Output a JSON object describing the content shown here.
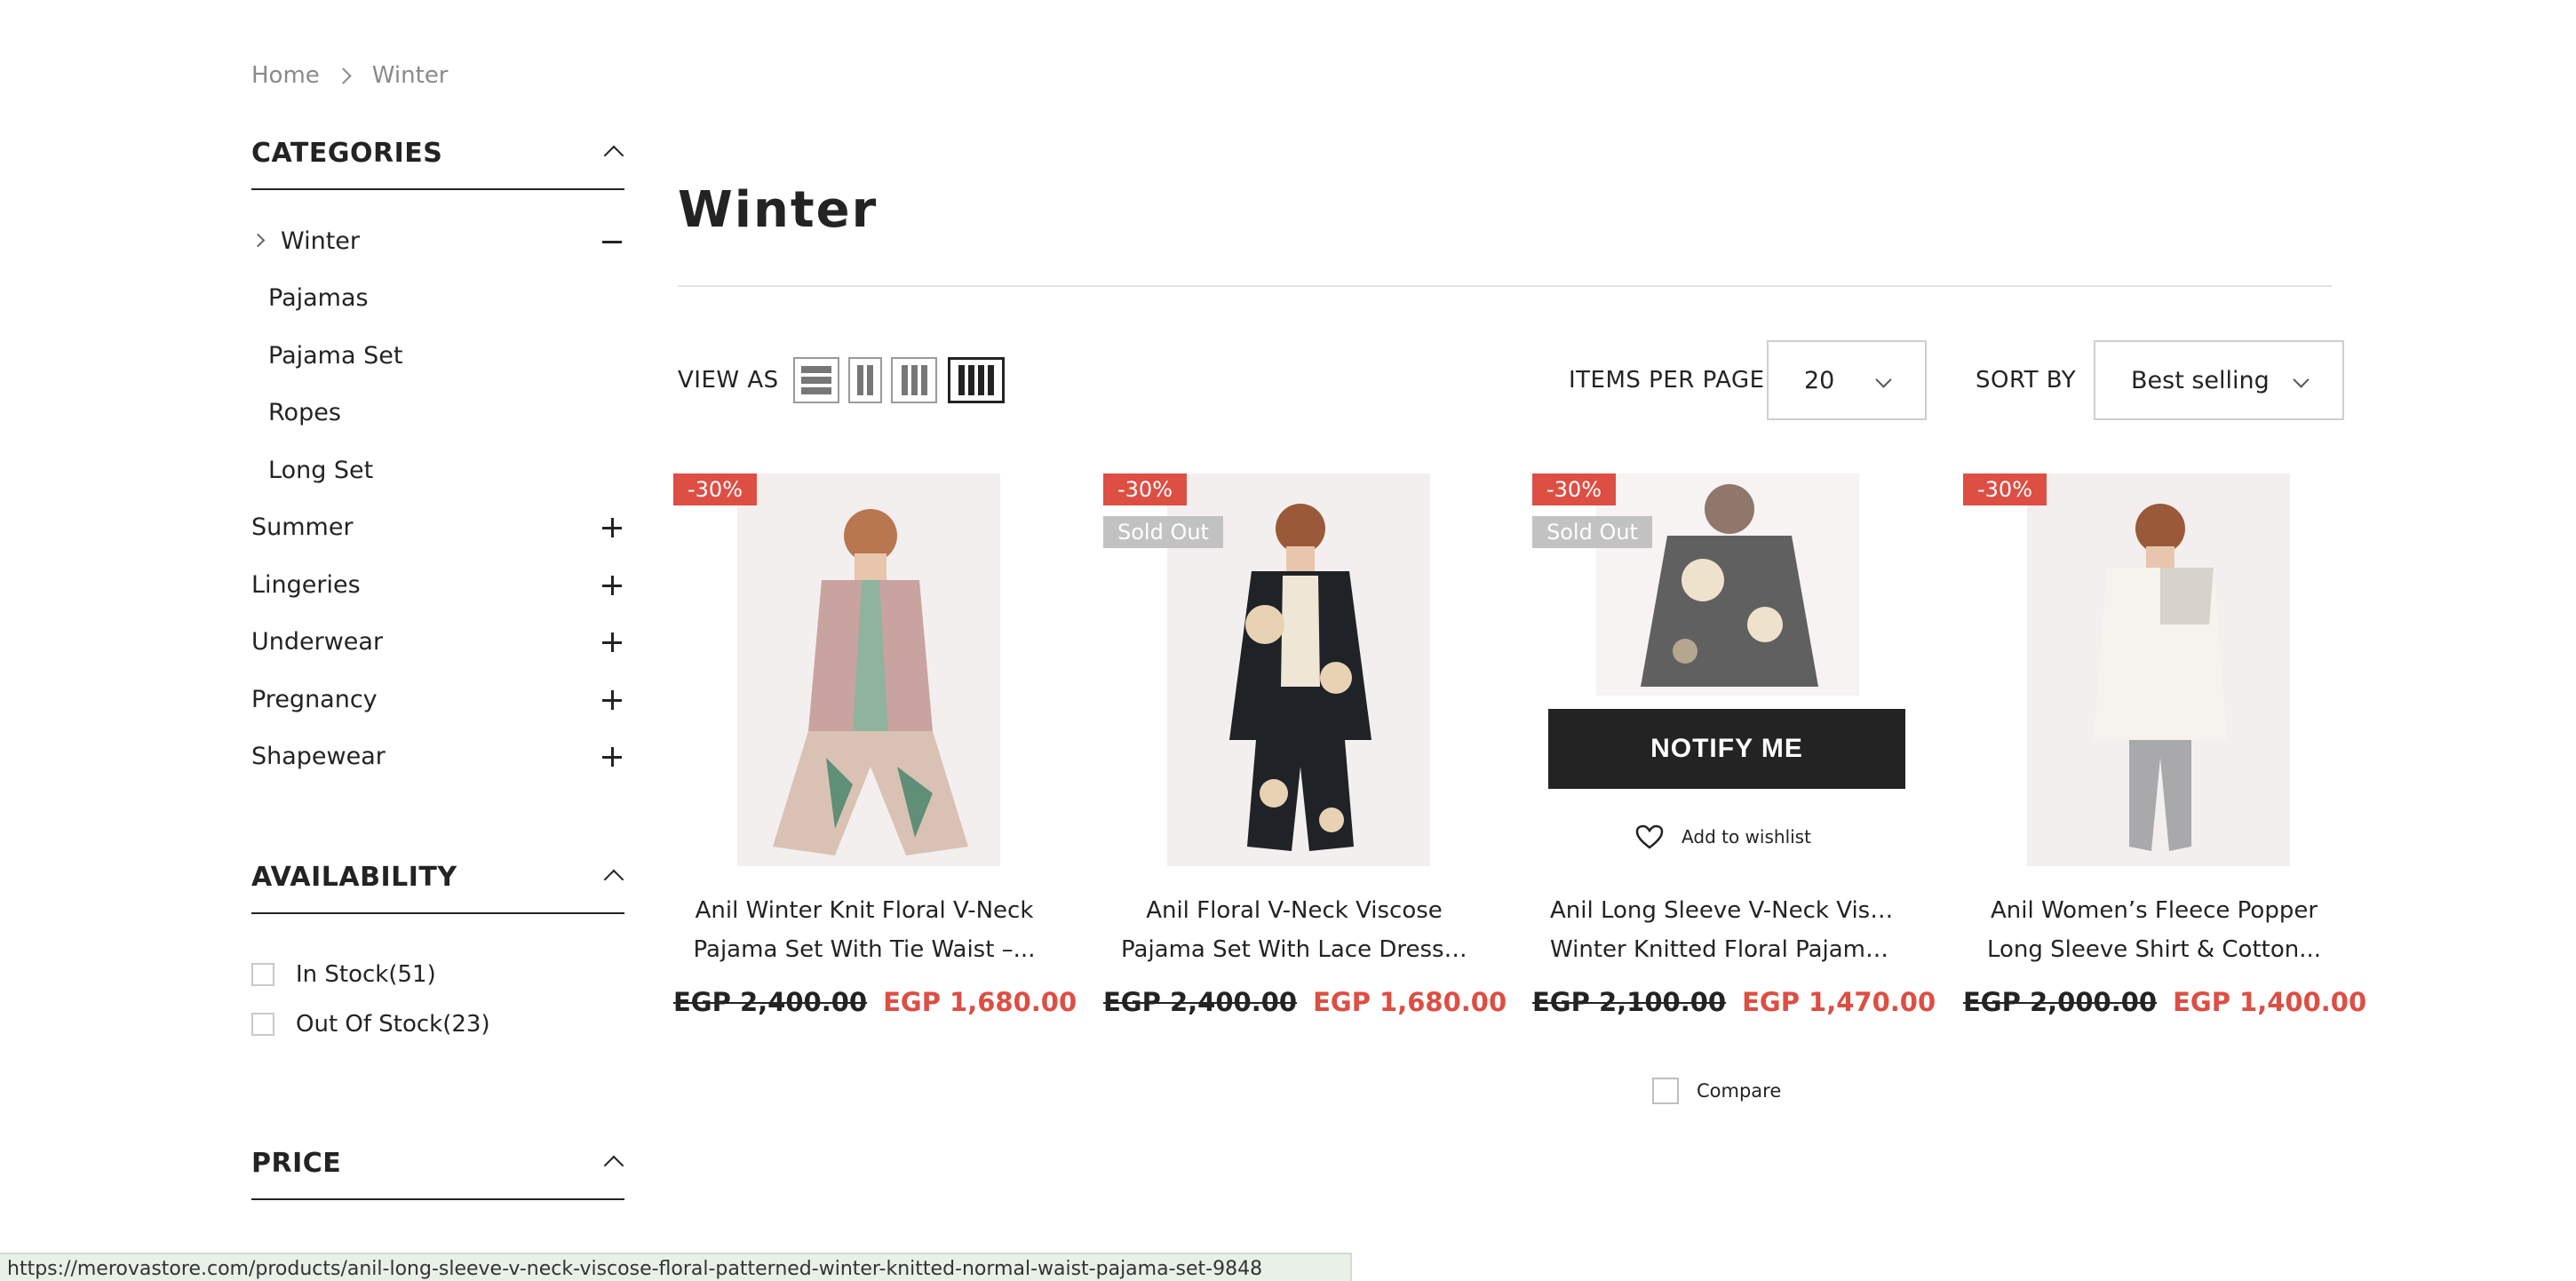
{
  "breadcrumb": {
    "home": "Home",
    "current": "Winter"
  },
  "sidebar": {
    "categories_title": "CATEGORIES",
    "items": [
      {
        "label": "Winter",
        "expanded": true
      },
      {
        "label": "Pajamas"
      },
      {
        "label": "Pajama Set"
      },
      {
        "label": "Ropes"
      },
      {
        "label": "Long Set"
      },
      {
        "label": "Summer"
      },
      {
        "label": "Lingeries"
      },
      {
        "label": "Underwear"
      },
      {
        "label": "Pregnancy"
      },
      {
        "label": "Shapewear"
      }
    ],
    "availability_title": "AVAILABILITY",
    "availability": [
      {
        "label": "In Stock(51)"
      },
      {
        "label": "Out Of Stock(23)"
      }
    ],
    "price_title": "PRICE"
  },
  "main": {
    "title": "Winter",
    "view_as_label": "VIEW AS",
    "items_per_page_label": "ITEMS PER PAGE",
    "items_per_page_value": "20",
    "sort_by_label": "SORT BY",
    "sort_by_value": "Best selling"
  },
  "products": [
    {
      "badge": "-30%",
      "sold_out": "",
      "name_line1": "Anil Winter Knit Floral V-Neck",
      "name_line2": "Pajama Set With Tie Waist –...",
      "old_price": "EGP 2,400.00",
      "new_price": "EGP 1,680.00"
    },
    {
      "badge": "-30%",
      "sold_out": "Sold Out",
      "name_line1": "Anil Floral V-Neck Viscose",
      "name_line2": "Pajama Set With Lace Dressing...",
      "old_price": "EGP 2,400.00",
      "new_price": "EGP 1,680.00"
    },
    {
      "badge": "-30%",
      "sold_out": "Sold Out",
      "name_line1": "Anil Long Sleeve V-Neck Viscose",
      "name_line2": "Winter Knitted Floral Pajama S...",
      "old_price": "EGP 2,100.00",
      "new_price": "EGP 1,470.00",
      "notify_label": "NOTIFY ME",
      "wishlist_label": "Add to wishlist"
    },
    {
      "badge": "-30%",
      "sold_out": "",
      "name_line1": "Anil Women’s Fleece Popper",
      "name_line2": "Long Sleeve Shirt & Cotton...",
      "old_price": "EGP 2,000.00",
      "new_price": "EGP 1,400.00"
    }
  ],
  "compare_label": "Compare",
  "status_bar_url": "https://merovastore.com/products/anil-long-sleeve-v-neck-viscose-floral-patterned-winter-knitted-normal-waist-pajama-set-9848",
  "colors": {
    "accent": "#dd4e43",
    "dark": "#232323",
    "sold_out": "#c2c2c2"
  }
}
